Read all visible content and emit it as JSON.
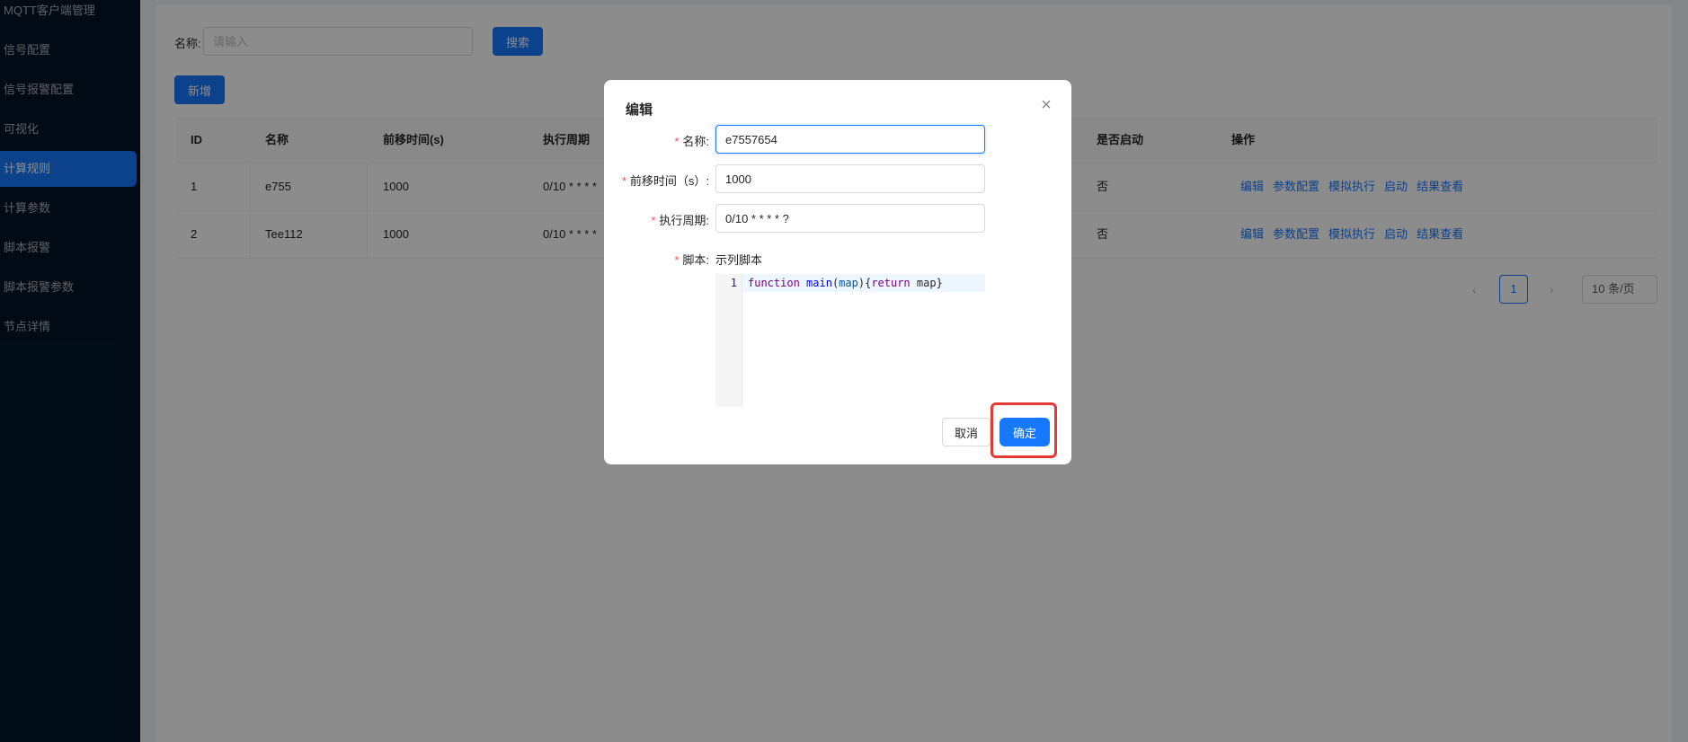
{
  "sidebar": {
    "items": [
      {
        "label": "MQTT客户端管理"
      },
      {
        "label": "信号配置"
      },
      {
        "label": "信号报警配置"
      },
      {
        "label": "可视化"
      },
      {
        "label": "计算规则",
        "active": true
      },
      {
        "label": "计算参数"
      },
      {
        "label": "脚本报警"
      },
      {
        "label": "脚本报警参数"
      },
      {
        "label": "节点详情"
      }
    ]
  },
  "search": {
    "label": "名称:",
    "placeholder": "请输入",
    "button": "搜索"
  },
  "toolbar": {
    "add_label": "新增"
  },
  "table": {
    "headers": [
      "ID",
      "名称",
      "前移时间(s)",
      "执行周期",
      "是否启动",
      "操作"
    ],
    "rows": [
      {
        "id": "1",
        "name": "e755",
        "shift": "1000",
        "cron": "0/10 * * * *",
        "enabled": "否"
      },
      {
        "id": "2",
        "name": "Tee112",
        "shift": "1000",
        "cron": "0/10 * * * *",
        "enabled": "否"
      }
    ],
    "actions": [
      "编辑",
      "参数配置",
      "模拟执行",
      "启动",
      "结果查看"
    ]
  },
  "pagination": {
    "prev": "‹",
    "current": "1",
    "next": "›",
    "page_size": "10 条/页"
  },
  "modal": {
    "title": "编辑",
    "fields": {
      "name_label": "名称:",
      "name_value": "e7557654",
      "shift_label": "前移时间（s）:",
      "shift_value": "1000",
      "cron_label": "执行周期:",
      "cron_value": "0/10 * * * * ?",
      "script_label": "脚本:",
      "script_example": "示列脚本"
    },
    "editor": {
      "line_number": "1",
      "tokens": {
        "kw1": "function",
        "fn": "main",
        "p1": "(",
        "param": "map",
        "p2": "){",
        "kw2": "return",
        "rest": " map}"
      }
    },
    "cancel": "取消",
    "confirm": "确定"
  },
  "colors": {
    "primary": "#1677ff",
    "sidebar_bg": "#001529",
    "highlight": "#e53935",
    "required": "#ff4d4f"
  }
}
